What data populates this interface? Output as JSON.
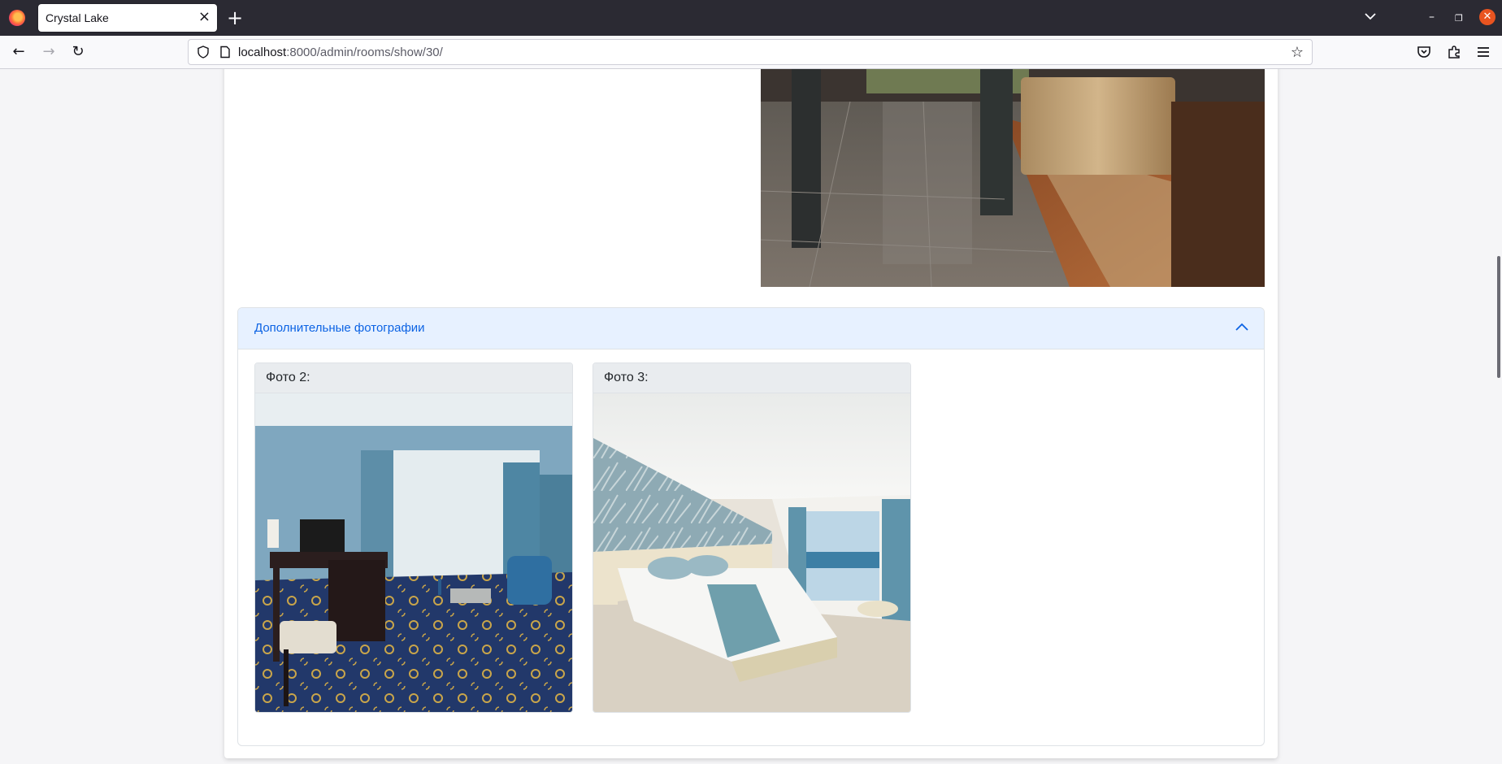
{
  "browser": {
    "tab_title": "Crystal Lake",
    "url_host": "localhost",
    "url_rest": ":8000/admin/rooms/show/30/"
  },
  "accordion": {
    "title": "Дополнительные фотографии"
  },
  "photos": [
    {
      "label": "Фото 2:"
    },
    {
      "label": "Фото 3:"
    }
  ]
}
